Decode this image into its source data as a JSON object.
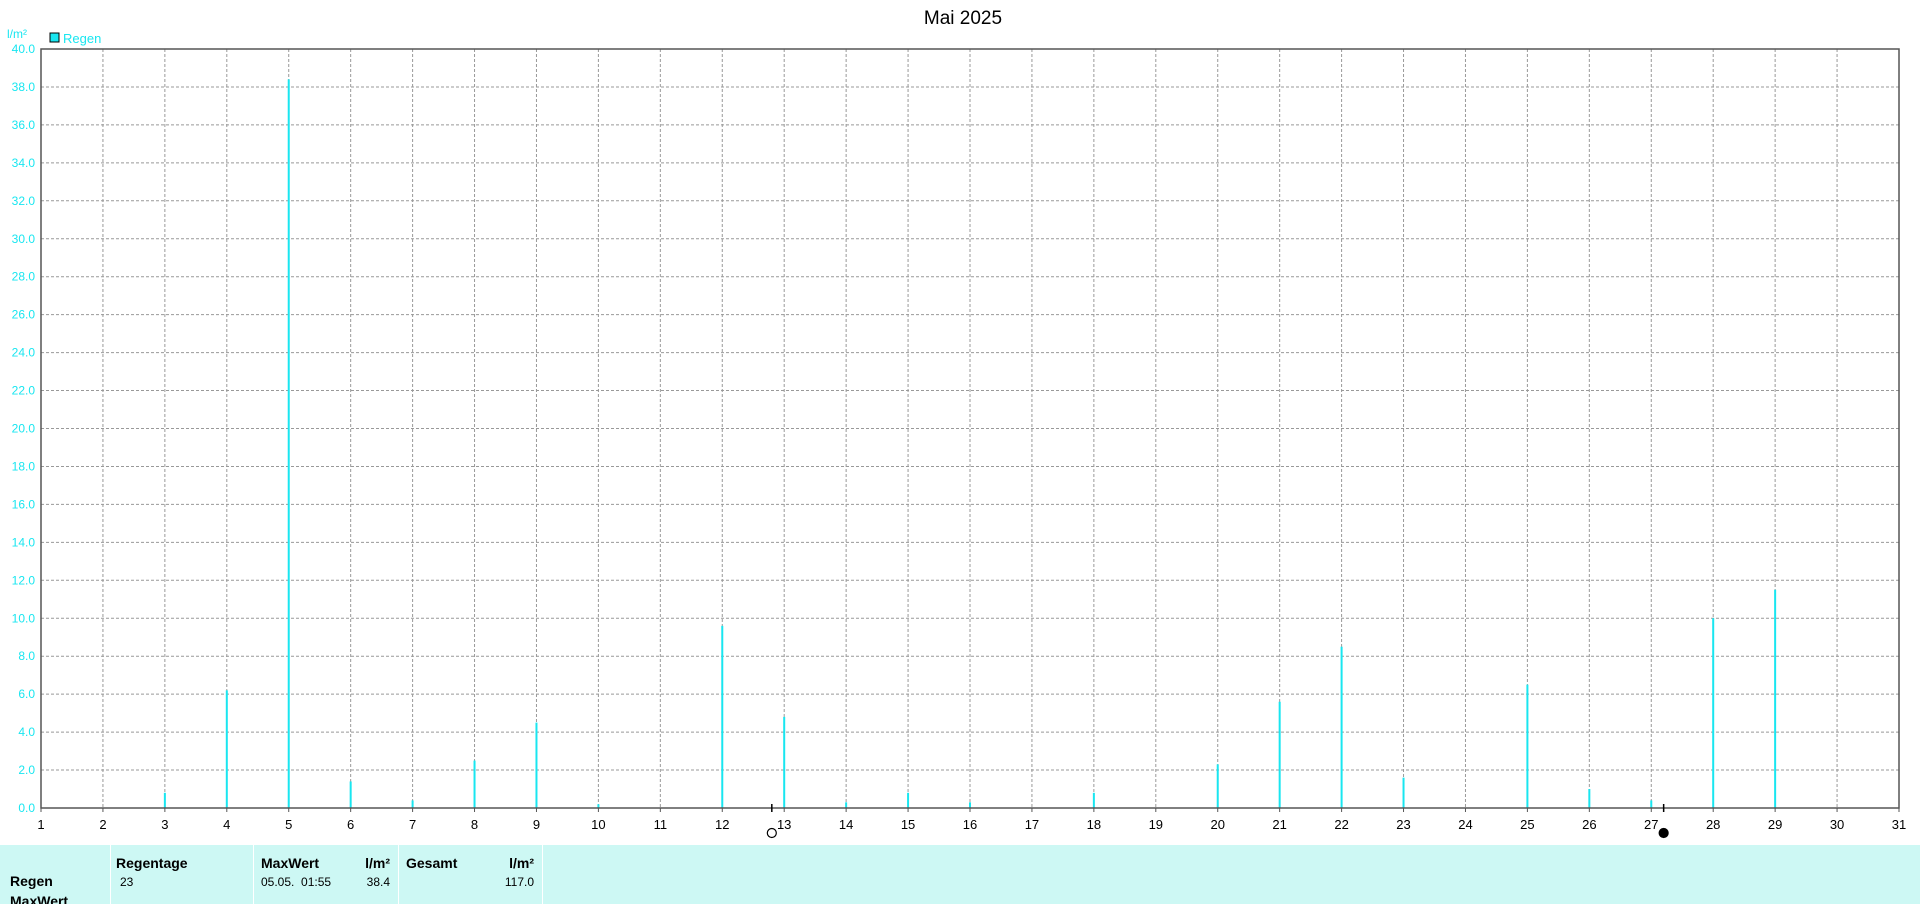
{
  "chart_data": {
    "type": "bar",
    "title": "Mai 2025",
    "ylabel": "l/m²",
    "legend": {
      "entries": [
        "Regen"
      ],
      "position": "top-left"
    },
    "ylim": [
      0,
      40
    ],
    "grid": true,
    "y_ticks": [
      "0.0",
      "2.0",
      "4.0",
      "6.0",
      "8.0",
      "10.0",
      "12.0",
      "14.0",
      "16.0",
      "18.0",
      "20.0",
      "22.0",
      "24.0",
      "26.0",
      "28.0",
      "30.0",
      "32.0",
      "34.0",
      "36.0",
      "38.0",
      "40.0"
    ],
    "x_ticks": [
      "1",
      "2",
      "3",
      "4",
      "5",
      "6",
      "7",
      "8",
      "9",
      "10",
      "11",
      "12",
      "13",
      "14",
      "15",
      "16",
      "17",
      "18",
      "19",
      "20",
      "21",
      "22",
      "23",
      "24",
      "25",
      "26",
      "27",
      "28",
      "29",
      "30",
      "31"
    ],
    "xlim": [
      1,
      31
    ],
    "series": [
      {
        "name": "Regen",
        "color": "#19e6f0",
        "points": [
          {
            "x": 3,
            "y": 0.8
          },
          {
            "x": 4,
            "y": 6.2
          },
          {
            "x": 5,
            "y": 38.4
          },
          {
            "x": 6,
            "y": 1.4
          },
          {
            "x": 7,
            "y": 0.4
          },
          {
            "x": 8,
            "y": 2.5
          },
          {
            "x": 9,
            "y": 4.5
          },
          {
            "x": 10,
            "y": 0.2
          },
          {
            "x": 12,
            "y": 9.6
          },
          {
            "x": 13,
            "y": 4.8
          },
          {
            "x": 14,
            "y": 0.3
          },
          {
            "x": 15,
            "y": 0.8
          },
          {
            "x": 16,
            "y": 0.3
          },
          {
            "x": 18,
            "y": 0.8
          },
          {
            "x": 20,
            "y": 2.3
          },
          {
            "x": 21,
            "y": 5.6
          },
          {
            "x": 22,
            "y": 8.5
          },
          {
            "x": 23,
            "y": 1.6
          },
          {
            "x": 25,
            "y": 6.5
          },
          {
            "x": 26,
            "y": 1.0
          },
          {
            "x": 27,
            "y": 0.4
          },
          {
            "x": 28,
            "y": 10.0
          },
          {
            "x": 29,
            "y": 11.5
          }
        ]
      }
    ],
    "moon_phases": [
      {
        "phase": "full-moon",
        "x": 12.8
      },
      {
        "phase": "new-moon",
        "x": 27.2
      }
    ]
  },
  "stats": {
    "row_labels": [
      "Regen",
      "MaxWert"
    ],
    "regentage": {
      "header": "Regentage",
      "value": "23"
    },
    "maxwert": {
      "header": "MaxWert",
      "unit": "l/m²",
      "date": "05.05.  01:55",
      "value": "38.4"
    },
    "gesamt": {
      "header": "Gesamt",
      "unit": "l/m²",
      "value": "117.0"
    }
  }
}
